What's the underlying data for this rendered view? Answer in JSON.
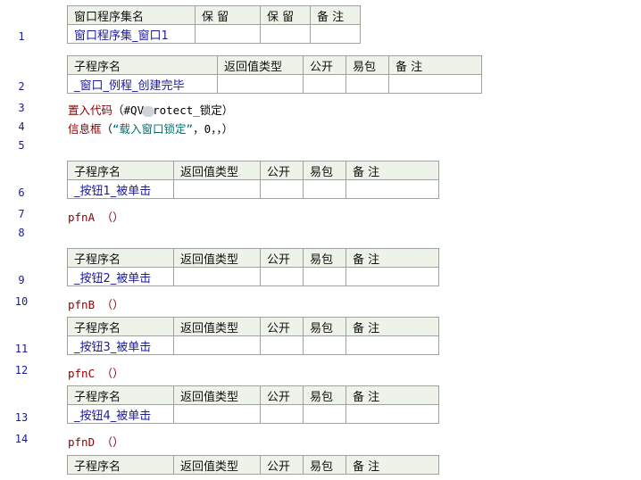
{
  "program_set_table": {
    "headers": [
      "窗口程序集名",
      "保 留",
      "保 留",
      "备 注"
    ],
    "row": [
      "窗口程序集_窗口1",
      "",
      "",
      ""
    ]
  },
  "subroutine_headers_wide": [
    "子程序名",
    "返回值类型",
    "公开",
    "易包",
    "备 注"
  ],
  "subroutines": [
    {
      "name": "_窗口_例程_创建完毕"
    },
    {
      "name": "_按钮1_被单击"
    },
    {
      "name": "_按钮2_被单击"
    },
    {
      "name": "_按钮3_被单击"
    },
    {
      "name": "_按钮4_被单击"
    }
  ],
  "last_header": [
    "子程序名",
    "返回值类型",
    "公开",
    "易包",
    "备 注"
  ],
  "line_numbers": [
    "1",
    "2",
    "3",
    "4",
    "5",
    "6",
    "7",
    "8",
    "9",
    "10",
    "11",
    "12",
    "13",
    "14"
  ],
  "code": {
    "line3_kw": "置入代码",
    "line3_open": "（#QV",
    "line3_rest": "rotect_锁定）",
    "line4_kw": "信息框",
    "line4_open": "（",
    "line4_str": "“载入窗口锁定”",
    "line4_rest": "，0，，）",
    "line7": "pfnA （）",
    "line10": "pfnB （）",
    "line12": "pfnC （）",
    "line14": "pfnD （）"
  }
}
